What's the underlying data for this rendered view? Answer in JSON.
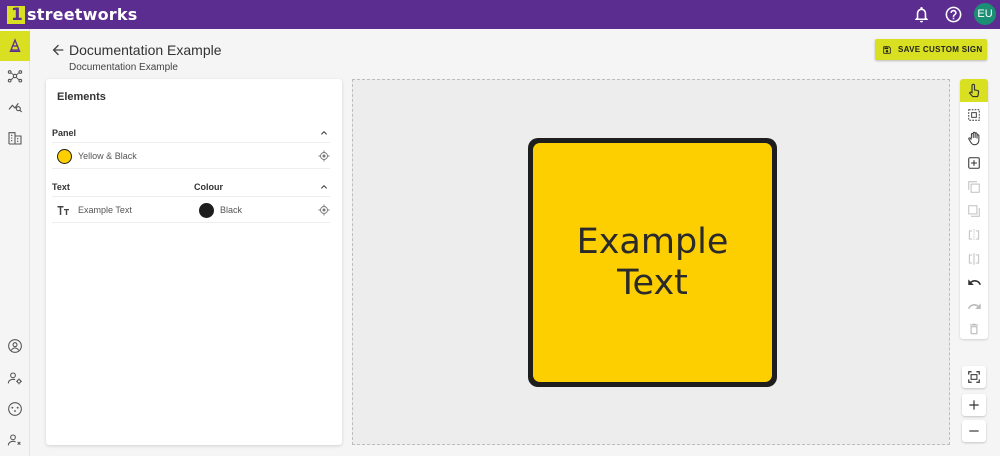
{
  "app": {
    "logo_text": "streetworks",
    "user_initials": "EU"
  },
  "header": {
    "title": "Documentation Example",
    "subtitle": "Documentation Example",
    "save_label": "SAVE CUSTOM SIGN"
  },
  "elements": {
    "title": "Elements",
    "panel_section": {
      "label": "Panel",
      "items": [
        {
          "label": "Yellow & Black",
          "swatch_color": "#fecf00"
        }
      ]
    },
    "text_section": {
      "label": "Text",
      "colour_label": "Colour",
      "items": [
        {
          "label": "Example Text",
          "colour_label": "Black",
          "swatch_color": "#1e1e1e"
        }
      ]
    }
  },
  "sign": {
    "text": "Example Text",
    "panel_color": "#fecf00",
    "border_color": "#1e1e1e"
  },
  "colors": {
    "brand_purple": "#5c2d91",
    "accent_yellow": "#d9e021",
    "avatar_green": "#1a8f74"
  },
  "icons": {
    "left_nav": [
      "cone-icon",
      "network-icon",
      "analytics-icon",
      "building-icon",
      "account-icon",
      "user-settings-icon",
      "support-icon",
      "user-admin-icon"
    ],
    "toolbar": [
      "pointer-icon",
      "select-icon",
      "pan-icon",
      "add-element-icon",
      "bring-forward-icon",
      "send-backward-icon",
      "flip-horizontal-icon",
      "flip-vertical-icon",
      "undo-icon",
      "redo-icon",
      "delete-icon"
    ]
  }
}
